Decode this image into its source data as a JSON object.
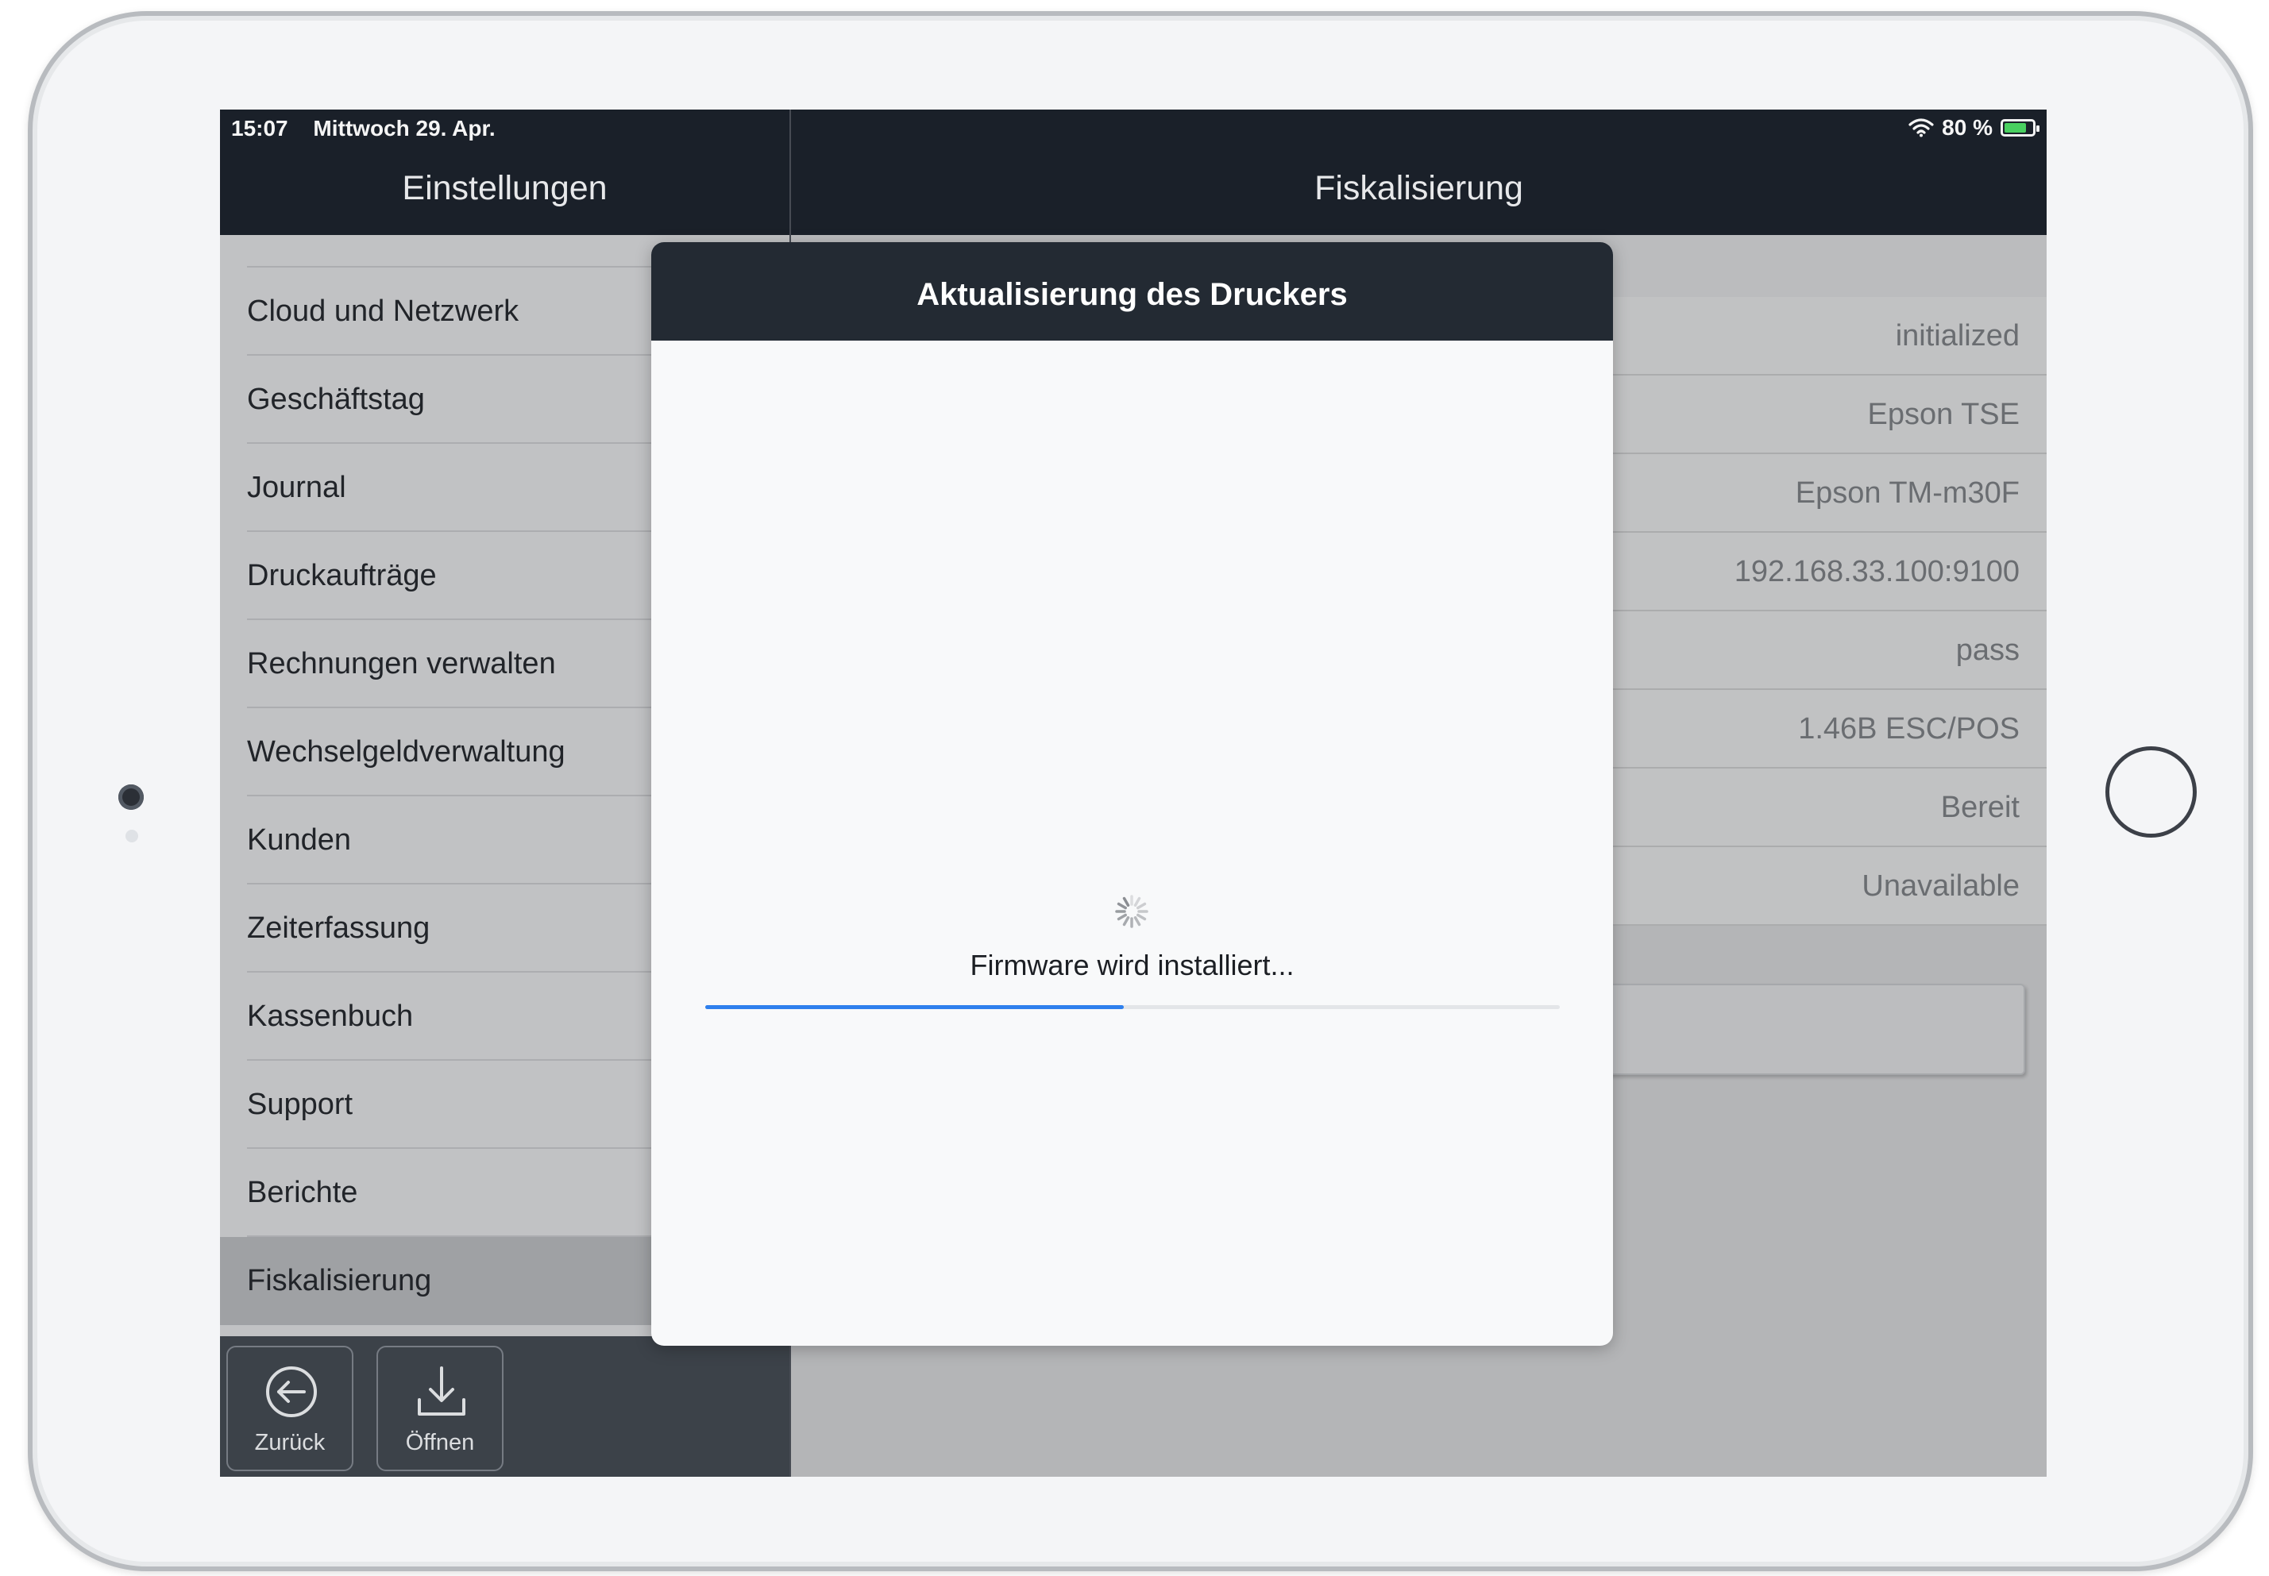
{
  "status_bar": {
    "time": "15:07",
    "date": "Mittwoch 29. Apr.",
    "battery_text": "80 %",
    "battery_level": 0.8
  },
  "master": {
    "title": "Einstellungen",
    "items": [
      {
        "label": "Cloud und Netzwerk"
      },
      {
        "label": "Geschäftstag"
      },
      {
        "label": "Journal"
      },
      {
        "label": "Druckaufträge"
      },
      {
        "label": "Rechnungen verwalten"
      },
      {
        "label": "Wechselgeldverwaltung"
      },
      {
        "label": "Kunden"
      },
      {
        "label": "Zeiterfassung"
      },
      {
        "label": "Kassenbuch"
      },
      {
        "label": "Support"
      },
      {
        "label": "Berichte"
      },
      {
        "label": "Fiskalisierung"
      }
    ],
    "selected_item": "Fiskalisierung",
    "toolbar": {
      "back_label": "Zurück",
      "open_label": "Öffnen"
    }
  },
  "detail": {
    "title": "Fiskalisierung",
    "values": [
      "initialized",
      "Epson TSE",
      "Epson TM-m30F",
      "192.168.33.100:9100",
      "pass",
      "1.46B ESC/POS",
      "Bereit",
      "Unavailable"
    ]
  },
  "modal": {
    "title": "Aktualisierung des Druckers",
    "progress_label": "Firmware wird installiert...",
    "progress_fraction": 0.49
  },
  "colors": {
    "header_dark": "#1c222b",
    "progress_blue": "#2f80ed",
    "battery_green": "#4cd964"
  }
}
